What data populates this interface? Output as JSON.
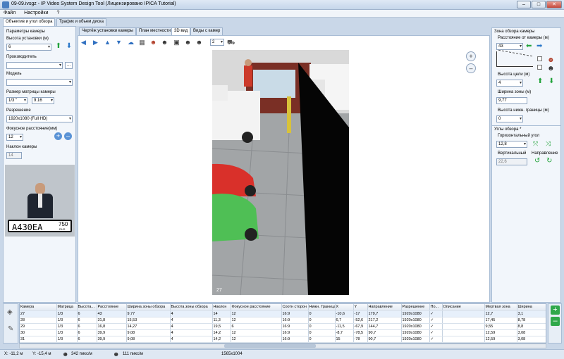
{
  "window": {
    "title": "09-09.ivsgz - IP Video System Design Tool (Лицензировано  IPICA Tutorial)",
    "minimize": "–",
    "maximize": "□",
    "close": "✕"
  },
  "menu": [
    "Файл",
    "Настройки",
    "?"
  ],
  "left_tabs": [
    "Объектив и угол обзора",
    "Трафик и объем диска"
  ],
  "left": {
    "camera_params": "Параметры камеры",
    "install_height_label": "Высота установки (м)",
    "install_height": "6",
    "manufacturer_label": "Производитель",
    "manufacturer": "",
    "model_label": "Модель",
    "model": "",
    "sensor_label": "Размер матрицы камеры",
    "sensor": "1/3 \"",
    "sensor_mm": "9.16",
    "resolution_label": "Разрешение",
    "resolution": "1920x1080 (Full HD)",
    "focal_label": "Фокусное расстояние(мм)",
    "focal": "12",
    "tilt_label": "Наклон камеры",
    "tilt": "14",
    "plate": "А430ЕА",
    "plate_region": "750",
    "plate_rus": "RUS"
  },
  "center_tabs": [
    "Чертёж установки камеры",
    "План местности",
    "3D вид",
    "Виды с камер"
  ],
  "view": {
    "label": "27",
    "page_selector": "2"
  },
  "right": {
    "zone_title": "Зона обзора камеры",
    "distance_label": "Расстояние от камеры (м)",
    "distance": "43",
    "target_height_label": "Высота цели (м)",
    "target_height": "4",
    "zone_width_label": "Ширина зоны (м)",
    "zone_width": "9,77",
    "lower_bound_label": "Высота нижн. границы (м)",
    "lower_bound": "0",
    "angles_title": "Углы обзора *",
    "horizontal_label": "Горизонтальный угол",
    "horizontal": "12,8",
    "vertical_label": "Вертикальный",
    "vertical": "22,6",
    "direction_label": "Направление"
  },
  "grid": {
    "headers": [
      "Камера",
      "Матрица",
      "Высота...",
      "Расстояние",
      "Ширина зоны обзора",
      "Высота зоны обзора",
      "Наклон",
      "Фокусное расстояние",
      "Соотн сторон",
      "Нижн. Граница",
      "X",
      "Y",
      "Направление",
      "Разрешение",
      "По...",
      "Описание",
      "Мертвая зона",
      "Ширина"
    ],
    "rows": [
      [
        "27",
        "1/3",
        "6",
        "43",
        "9,77",
        "4",
        "14",
        "12",
        "16:9",
        "0",
        "-10,6",
        "-17",
        "179,7",
        "1920x1080",
        "✓",
        "",
        "12,7",
        "3,1"
      ],
      [
        "28",
        "1/3",
        "6",
        "31,8",
        "15,53",
        "4",
        "11,3",
        "12",
        "16:9",
        "0",
        "6,7",
        "-52,6",
        "217,2",
        "1920x1080",
        "✓",
        "",
        "17,45",
        "8,78"
      ],
      [
        "29",
        "1/3",
        "6",
        "16,8",
        "14,27",
        "4",
        "19,5",
        "6",
        "16:9",
        "0",
        "-11,5",
        "-67,9",
        "144,7",
        "1920x1080",
        "✓",
        "",
        "9,55",
        "8,8"
      ],
      [
        "30",
        "1/3",
        "6",
        "39,9",
        "9,08",
        "4",
        "14,2",
        "12",
        "16:9",
        "0",
        "-8,7",
        "-78,5",
        "90,7",
        "1920x1080",
        "✓",
        "",
        "12,59",
        "3,08"
      ],
      [
        "31",
        "1/3",
        "6",
        "39,9",
        "9,08",
        "4",
        "14,2",
        "12",
        "16:9",
        "0",
        "15",
        "-78",
        "90,7",
        "1920x1080",
        "✓",
        "",
        "12,59",
        "3,08"
      ]
    ]
  },
  "status": {
    "x": "X: -11,2 м",
    "y": "Y: -15,4 м",
    "px1": "342 пикс/м",
    "px2": "111 пикс/м",
    "res": "1565x1004"
  }
}
